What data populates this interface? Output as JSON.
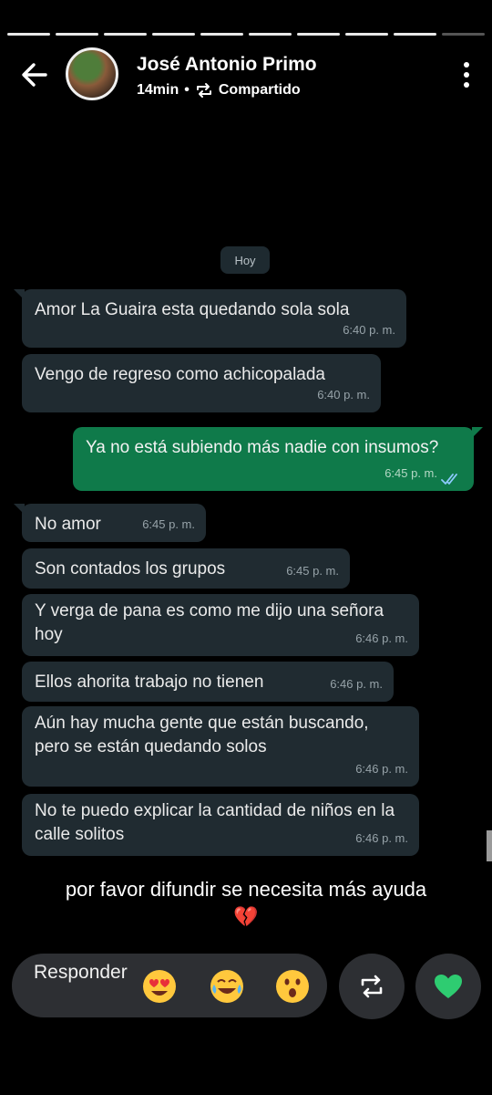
{
  "story": {
    "author": "José Antonio Primo",
    "time_ago": "14min",
    "separator": "•",
    "shared_label": "Compartido",
    "segments": 10
  },
  "chat": {
    "date_chip": "Hoy",
    "messages": [
      {
        "dir": "in",
        "text": "Amor La Guaira esta quedando sola sola",
        "time": "6:40 p. m."
      },
      {
        "dir": "in",
        "text": "Vengo de regreso como achicopalada",
        "time": "6:40 p. m."
      },
      {
        "dir": "out",
        "text": "Ya no está subiendo más nadie con insumos?",
        "time": "6:45 p. m."
      },
      {
        "dir": "in",
        "text": "No amor",
        "time": "6:45 p. m."
      },
      {
        "dir": "in",
        "text": "Son contados los grupos",
        "time": "6:45 p. m."
      },
      {
        "dir": "in",
        "text": "Y verga de pana es como me dijo una señora hoy",
        "time": "6:46 p. m."
      },
      {
        "dir": "in",
        "text": "Ellos ahorita trabajo no tienen",
        "time": "6:46 p. m."
      },
      {
        "dir": "in",
        "text": "Aún hay mucha gente que están buscando, pero se están quedando solos",
        "time": "6:46 p. m."
      },
      {
        "dir": "in",
        "text": "No te puedo explicar la cantidad de niños en la calle solitos",
        "time": "6:46 p. m."
      }
    ]
  },
  "caption": {
    "text": "por favor difundir se necesita más ayuda",
    "emoji": "💔"
  },
  "reply": {
    "label": "Responder",
    "emojis": [
      {
        "name": "heart-eyes-emoji-button",
        "glyph": "😍"
      },
      {
        "name": "laughing-emoji-button",
        "glyph": "😂"
      },
      {
        "name": "surprised-emoji-button",
        "glyph": "😮"
      }
    ]
  },
  "colors": {
    "incoming_bubble": "#202b31",
    "outgoing_bubble": "#0f7a4a",
    "like_heart": "#2ecc71"
  }
}
